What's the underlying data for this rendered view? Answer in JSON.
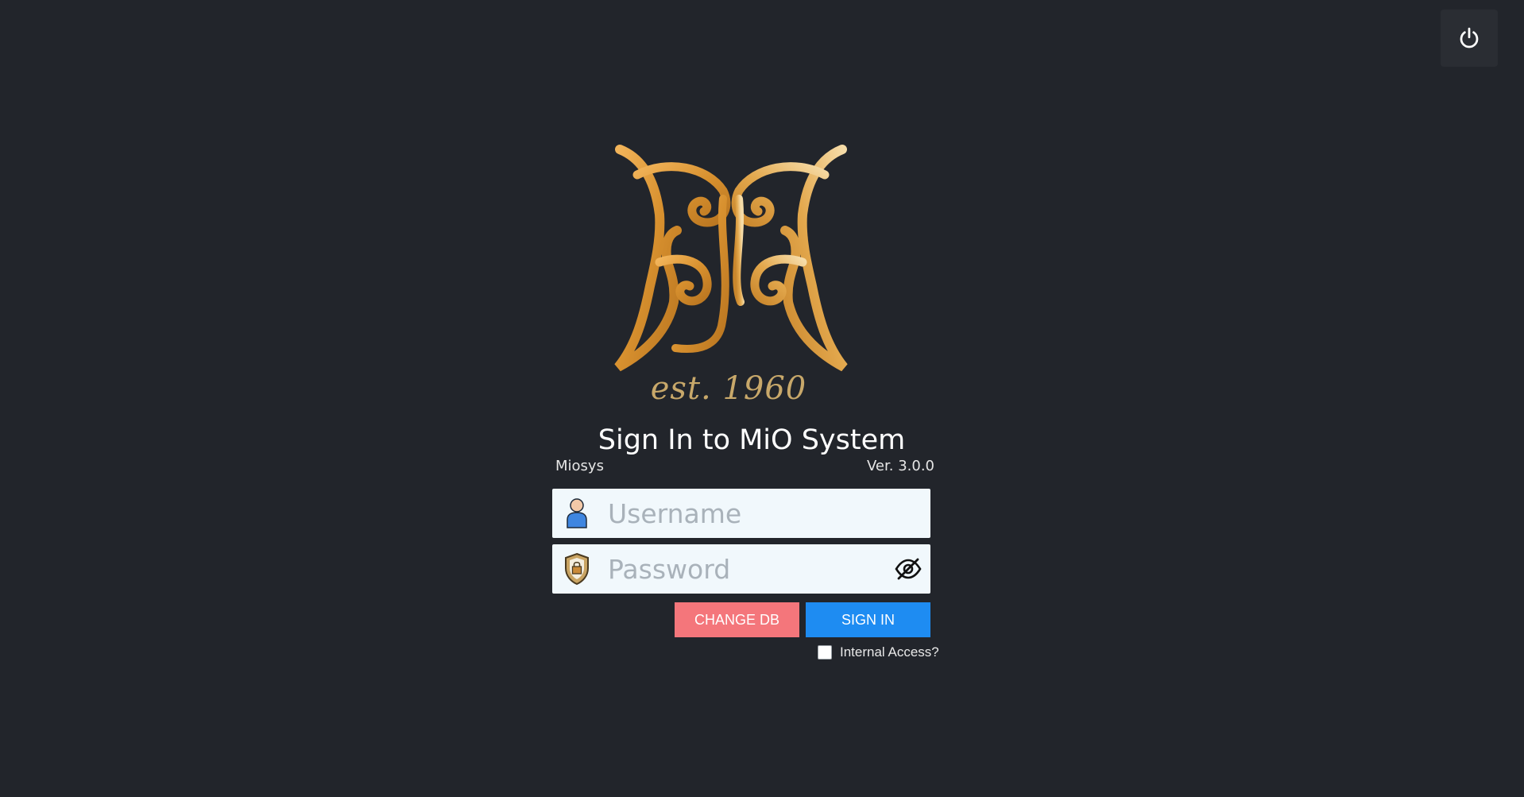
{
  "header": {
    "power_icon": "power-icon"
  },
  "brand": {
    "established": "est. 1960"
  },
  "login": {
    "title": "Sign In to MiO System",
    "app_name": "Miosys",
    "version": "Ver. 3.0.0",
    "username": {
      "placeholder": "Username",
      "value": "",
      "icon": "user-icon"
    },
    "password": {
      "placeholder": "Password",
      "value": "",
      "icon": "shield-lock-icon",
      "toggle_icon": "eye-slash-icon"
    },
    "change_db_label": "CHANGE DB",
    "sign_in_label": "SIGN IN",
    "internal_access_label": "Internal Access?",
    "internal_access_checked": false
  },
  "colors": {
    "background": "#22252b",
    "gold": "#d89a3c",
    "change_db": "#f4767b",
    "sign_in": "#1e8cf2",
    "field_bg": "#f1f8fc"
  }
}
